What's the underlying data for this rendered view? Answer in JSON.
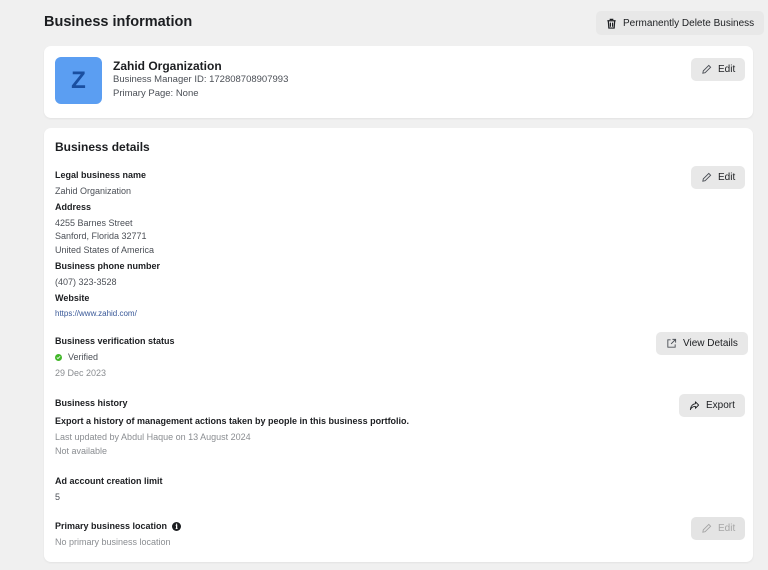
{
  "header": {
    "title": "Business information",
    "delete_button": "Permanently Delete Business"
  },
  "profile": {
    "avatar_letter": "Z",
    "name": "Zahid Organization",
    "manager_id": "Business Manager ID: 172808708907993",
    "primary_page": "Primary Page: None",
    "edit_button": "Edit"
  },
  "details": {
    "title": "Business details",
    "edit_button": "Edit",
    "legal_name_label": "Legal business name",
    "legal_name": "Zahid Organization",
    "address_label": "Address",
    "address_line1": "4255 Barnes Street",
    "address_line2": "Sanford, Florida 32771",
    "address_line3": "United States of America",
    "phone_label": "Business phone number",
    "phone": "(407) 323-3528",
    "website_label": "Website",
    "website": "https://www.zahid.com/",
    "verification_label": "Business verification status",
    "verification_status": "Verified",
    "verification_date": "29 Dec 2023",
    "view_details_button": "View Details",
    "history_label": "Business history",
    "history_description": "Export a history of management actions taken by people in this business portfolio.",
    "history_updated": "Last updated by Abdul Haque on 13 August 2024",
    "history_availability": "Not available",
    "export_button": "Export",
    "ad_limit_label": "Ad account creation limit",
    "ad_limit": "5",
    "location_label": "Primary business location",
    "location_value": "No primary business location",
    "location_edit_button": "Edit"
  },
  "colors": {
    "background": "#f0f0f0",
    "avatar_bg": "#5b9ef2",
    "avatar_letter": "#1a4fa0",
    "verified": "#42b72a",
    "link": "#385898"
  }
}
